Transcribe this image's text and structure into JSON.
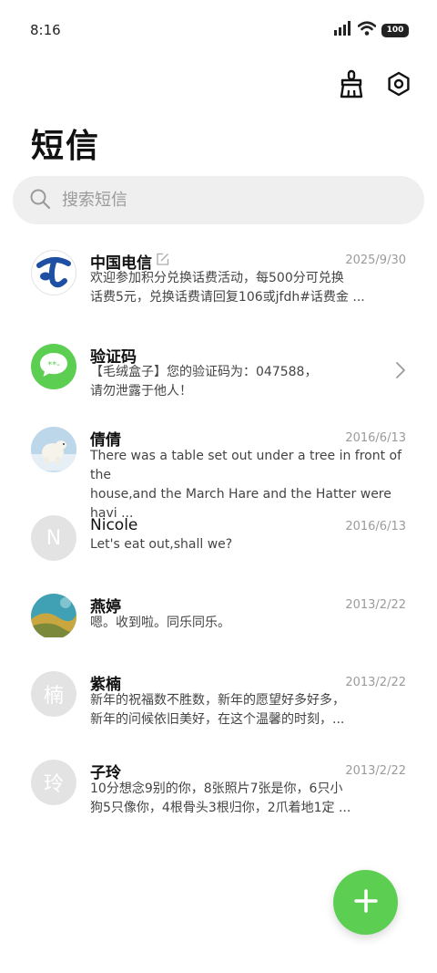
{
  "status_bar": {
    "time": "8:16",
    "battery": "100"
  },
  "header": {
    "title": "短信"
  },
  "search": {
    "placeholder": "搜索短信"
  },
  "messages": [
    {
      "name": "中国电信",
      "date": "2025/9/30",
      "preview_line1": "欢迎参加积分兑换话费活动，每500分可兑换",
      "preview_line2": "话费5元，兑换话费请回复106或jfdh#话费金 ..."
    },
    {
      "name": "验证码",
      "avatar_glyph": "**-",
      "preview_line1": "【毛绒盒子】您的验证码为：047588，",
      "preview_line2": "请勿泄露于他人！"
    },
    {
      "name": "倩倩",
      "date": "2016/6/13",
      "preview_line1": "There was a table set out under a tree in front of the",
      "preview_line2": "house,and the March Hare and the Hatter were havi ..."
    },
    {
      "name": "Nicole",
      "avatar_letter": "N",
      "date": "2016/6/13",
      "preview_line1": "Let's eat out,shall we?"
    },
    {
      "name": "燕婷",
      "date": "2013/2/22",
      "preview_line1": "嗯。收到啦。同乐同乐。"
    },
    {
      "name": "紫楠",
      "avatar_letter": "楠",
      "date": "2013/2/22",
      "preview_line1": "新年的祝福数不胜数，新年的愿望好多好多，",
      "preview_line2": "新年的问候依旧美好，在这个温馨的时刻，..."
    },
    {
      "name": "子玲",
      "avatar_letter": "玲",
      "date": "2013/2/22",
      "preview_line1": "10分想念9别的你，8张照片7张是你，6只小",
      "preview_line2": "狗5只像你，4根骨头3根归你，2爪着地1定 ..."
    }
  ],
  "colors": {
    "accent": "#5cce52",
    "telecom_blue": "#1e4fa3",
    "search_bg": "#efefef"
  },
  "icons": [
    "signal-icon",
    "wifi-icon",
    "broom-icon",
    "settings-icon",
    "search-icon",
    "edit-icon",
    "chevron-right-icon",
    "plus-icon"
  ]
}
